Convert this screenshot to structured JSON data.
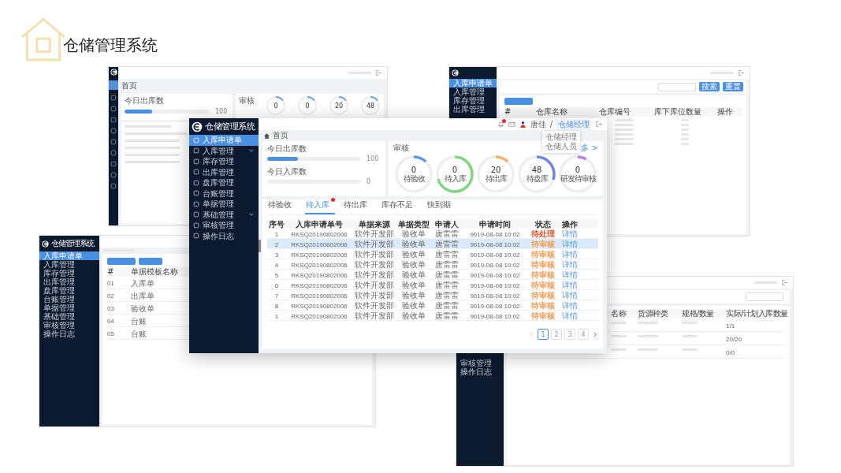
{
  "slide_title": "仓储管理系统",
  "main_window": {
    "logo_text": "仓储管理系统",
    "sidebar": [
      {
        "label": "入库申请单",
        "selected": true,
        "expandable": false
      },
      {
        "label": "入库管理",
        "selected": false,
        "expandable": true
      },
      {
        "label": "库存管理",
        "selected": false,
        "expandable": false
      },
      {
        "label": "出库管理",
        "selected": false,
        "expandable": false
      },
      {
        "label": "盘库管理",
        "selected": false,
        "expandable": false
      },
      {
        "label": "台账管理",
        "selected": false,
        "expandable": false
      },
      {
        "label": "单据管理",
        "selected": false,
        "expandable": false
      },
      {
        "label": "基础管理",
        "selected": false,
        "expandable": true
      },
      {
        "label": "审核管理",
        "selected": false,
        "expandable": false
      },
      {
        "label": "操作日志",
        "selected": false,
        "expandable": false
      }
    ],
    "header": {
      "user": "唐佳",
      "separator": "/",
      "role": "仓储经理"
    },
    "role_menu": [
      "仓储经理",
      "仓储人员"
    ],
    "breadcrumb": "首页",
    "stats": [
      {
        "label": "今日出库数",
        "level": 0.33,
        "value": "100"
      },
      {
        "label": "今日入库数",
        "level": 0,
        "value": "0"
      }
    ],
    "review": {
      "title": "审核",
      "more": "多 >",
      "rings": [
        {
          "value": "0",
          "label": "待验收",
          "level": 0.12,
          "color": "#5b9bea"
        },
        {
          "value": "0",
          "label": "待入库",
          "level": 0.7,
          "color": "#7fd67f"
        },
        {
          "value": "20",
          "label": "待出库",
          "level": 0.12,
          "color": "#f2b56b"
        },
        {
          "value": "48",
          "label": "待盘库",
          "level": 0.3,
          "color": "#6f86e6"
        },
        {
          "value": "0",
          "label": "研发待审核",
          "level": 0.08,
          "color": "#c07de0"
        }
      ]
    },
    "tabs": [
      {
        "label": "待验收",
        "selected": false,
        "badge": false
      },
      {
        "label": "待入库",
        "selected": true,
        "badge": true
      },
      {
        "label": "待出库",
        "selected": false,
        "badge": false
      },
      {
        "label": "库存不足",
        "selected": false,
        "badge": false
      },
      {
        "label": "快到期",
        "selected": false,
        "badge": false
      }
    ],
    "table": {
      "columns": [
        "序号",
        "入库申请单号",
        "单据来源",
        "单据类型",
        "申请人",
        "申请时间",
        "状态",
        "操作"
      ],
      "rows": [
        {
          "cells": [
            "1",
            "RKSQ20190802006",
            "软件开发部",
            "验收单",
            "唐雷雷",
            "9019-08-08 10:02",
            "待处理",
            "详情"
          ],
          "color": "#f0502a",
          "selected": false
        },
        {
          "cells": [
            "2",
            "RKSQ20190802006",
            "软件开发部",
            "验收单",
            "唐雷雷",
            "9019-08-08 10:02",
            "待审核",
            "详情"
          ],
          "color": "#f79a52",
          "selected": true
        },
        {
          "cells": [
            "3",
            "RKSQ20190802006",
            "软件开发部",
            "验收单",
            "唐雷雷",
            "9019-08-08 10:02",
            "待审核",
            "详情"
          ],
          "color": "#f79a52",
          "selected": false
        },
        {
          "cells": [
            "4",
            "RKSQ20190802006",
            "软件开发部",
            "验收单",
            "唐雷雷",
            "9019-08-08 10:02",
            "待审核",
            "详情"
          ],
          "color": "#f79a52",
          "selected": false
        },
        {
          "cells": [
            "5",
            "RKSQ20190802006",
            "软件开发部",
            "验收单",
            "唐雷雷",
            "9019-08-08 10:02",
            "待审核",
            "详情"
          ],
          "color": "#f79a52",
          "selected": false
        },
        {
          "cells": [
            "6",
            "RKSQ20190802006",
            "软件开发部",
            "验收单",
            "唐雷雷",
            "9019-08-08 10:02",
            "待审核",
            "详情"
          ],
          "color": "#f79a52",
          "selected": false
        },
        {
          "cells": [
            "7",
            "RKSQ20190802006",
            "软件开发部",
            "验收单",
            "唐雷雷",
            "9019-08-08 10:02",
            "待审核",
            "详情"
          ],
          "color": "#f79a52",
          "selected": false
        },
        {
          "cells": [
            "8",
            "RKSQ20190802006",
            "软件开发部",
            "验收单",
            "唐雷雷",
            "9019-08-08 10:02",
            "待审核",
            "详情"
          ],
          "color": "#f79a52",
          "selected": false
        },
        {
          "cells": [
            "1",
            "RKSQ20190802006",
            "软件开发部",
            "验收单",
            "唐雷雷",
            "9019-08-08 10:02",
            "待审核",
            "详情"
          ],
          "color": "#f79a52",
          "selected": false
        }
      ]
    },
    "pagination": [
      {
        "label": "1",
        "selected": true
      },
      {
        "label": "2",
        "selected": false
      },
      {
        "label": "3",
        "selected": false
      },
      {
        "label": "4",
        "selected": false
      }
    ]
  },
  "background_windows": [
    {
      "kind": "collapsed_dashboard",
      "breadcrumb": "首页",
      "stat": {
        "label": "今日出库数",
        "value": "100",
        "level": 0.33
      },
      "review_title": "审核",
      "ring_values": [
        "0",
        "0",
        "20",
        "48"
      ]
    },
    {
      "kind": "warehouse_list",
      "menu": [
        {
          "label": "入库申请单",
          "selected": true
        },
        {
          "label": "入库管理",
          "selected": false
        },
        {
          "label": "库存管理",
          "selected": false
        },
        {
          "label": "出库管理",
          "selected": false
        }
      ],
      "buttons": [
        "搜索",
        "重置"
      ],
      "columns": [
        "#",
        "仓库名称",
        "仓库编号",
        "库下库位数量",
        "操作"
      ]
    },
    {
      "kind": "template_list",
      "logo_text": "仓储管理系统",
      "menu": [
        {
          "label": "入库申请单",
          "selected": true
        },
        {
          "label": "入库管理",
          "selected": false
        },
        {
          "label": "库存管理",
          "selected": false
        },
        {
          "label": "出库管理",
          "selected": false
        },
        {
          "label": "盘库管理",
          "selected": false
        },
        {
          "label": "台账管理",
          "selected": false
        },
        {
          "label": "单据管理",
          "selected": false
        },
        {
          "label": "基础管理",
          "selected": false
        },
        {
          "label": "审核管理",
          "selected": false
        },
        {
          "label": "操作日志",
          "selected": false
        }
      ],
      "columns": [
        "#",
        "单据模板名称"
      ],
      "rows": [
        [
          "01",
          "入库单"
        ],
        [
          "02",
          "出库单"
        ],
        [
          "03",
          "验收单"
        ],
        [
          "04",
          "台账"
        ],
        [
          "05",
          "台账"
        ]
      ]
    },
    {
      "kind": "goods_list",
      "menu": [
        {
          "label": "审核管理",
          "selected": false
        },
        {
          "label": "操作日志",
          "selected": false
        }
      ],
      "columns": [
        "名称",
        "货源种类",
        "规格/数量",
        "实际/计划入库数量"
      ],
      "quantities": [
        "1/1",
        "20/20",
        "0/0"
      ]
    }
  ]
}
